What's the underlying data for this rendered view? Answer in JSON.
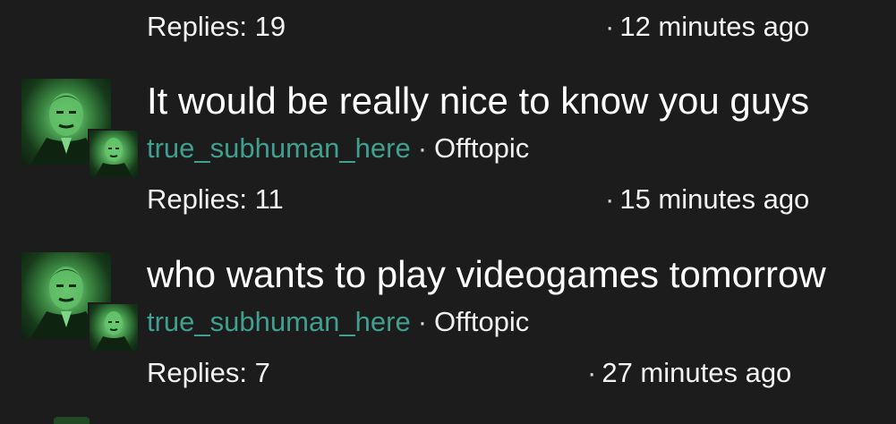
{
  "feed": {
    "top_meta": {
      "replies": "Replies: 19",
      "time": "12 minutes ago"
    },
    "threads": [
      {
        "title": "It would be really nice to know you guys",
        "user": "true_subhuman_here",
        "category": "Offtopic",
        "replies": "Replies: 11",
        "time": "15 minutes ago"
      },
      {
        "title": "who wants to play videogames tomorrow",
        "user": "true_subhuman_here",
        "category": "Offtopic",
        "replies": "Replies: 7",
        "time": "27 minutes ago"
      }
    ],
    "separator": "·"
  },
  "colors": {
    "background": "#1c1c1c",
    "username": "#3fa08f",
    "text": "#ffffff",
    "avatar_glow": "#3f8f46"
  },
  "icons": {
    "avatar": "portrait-avatar-icon",
    "sub_avatar": "small-portrait-avatar-icon"
  }
}
